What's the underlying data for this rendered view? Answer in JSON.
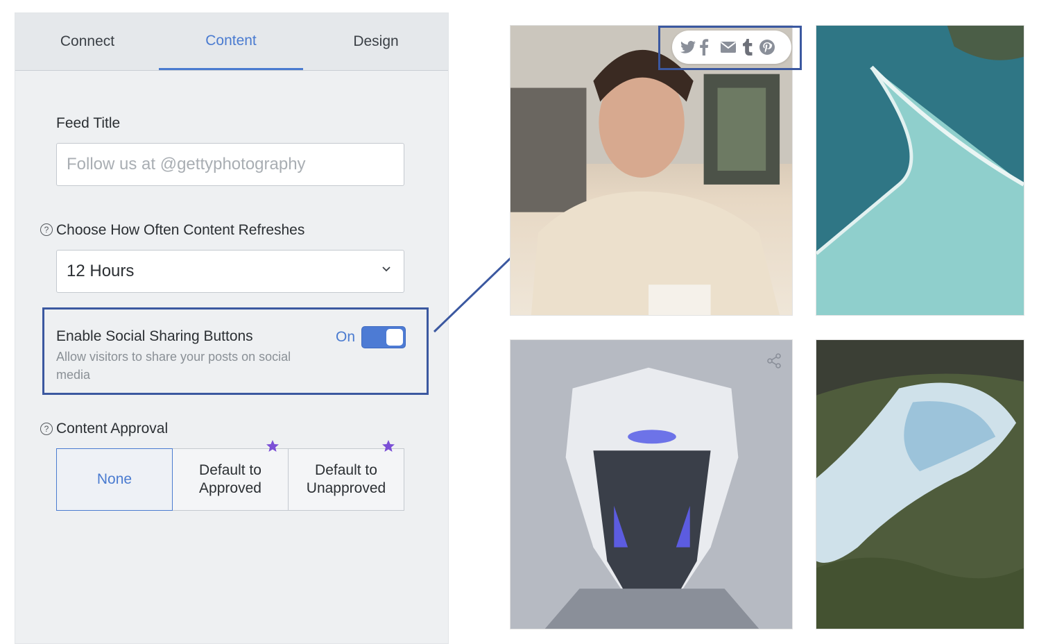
{
  "tabs": [
    {
      "label": "Connect",
      "active": false
    },
    {
      "label": "Content",
      "active": true
    },
    {
      "label": "Design",
      "active": false
    }
  ],
  "feed_title": {
    "label": "Feed Title",
    "placeholder": "Follow us at @gettyphotography",
    "value": ""
  },
  "refresh": {
    "help_icon": "question-circle-icon",
    "label": "Choose How Often Content Refreshes",
    "selected": "12 Hours"
  },
  "social_sharing": {
    "title": "Enable Social Sharing Buttons",
    "description": "Allow visitors to share your posts on social media",
    "toggle_label": "On",
    "enabled": true
  },
  "approval": {
    "help_icon": "question-circle-icon",
    "label": "Content Approval",
    "options": [
      {
        "label": "None",
        "selected": true,
        "premium": false
      },
      {
        "label": "Default to Approved",
        "selected": false,
        "premium": true
      },
      {
        "label": "Default to Unapproved",
        "selected": false,
        "premium": true
      }
    ]
  },
  "share_icons": [
    "twitter-icon",
    "facebook-icon",
    "email-icon",
    "tumblr-icon",
    "pinterest-icon"
  ],
  "colors": {
    "accent": "#4a7bd0",
    "highlight_border": "#3b58a0",
    "premium_star": "#7b4fd6",
    "panel_bg": "#eef0f2"
  }
}
